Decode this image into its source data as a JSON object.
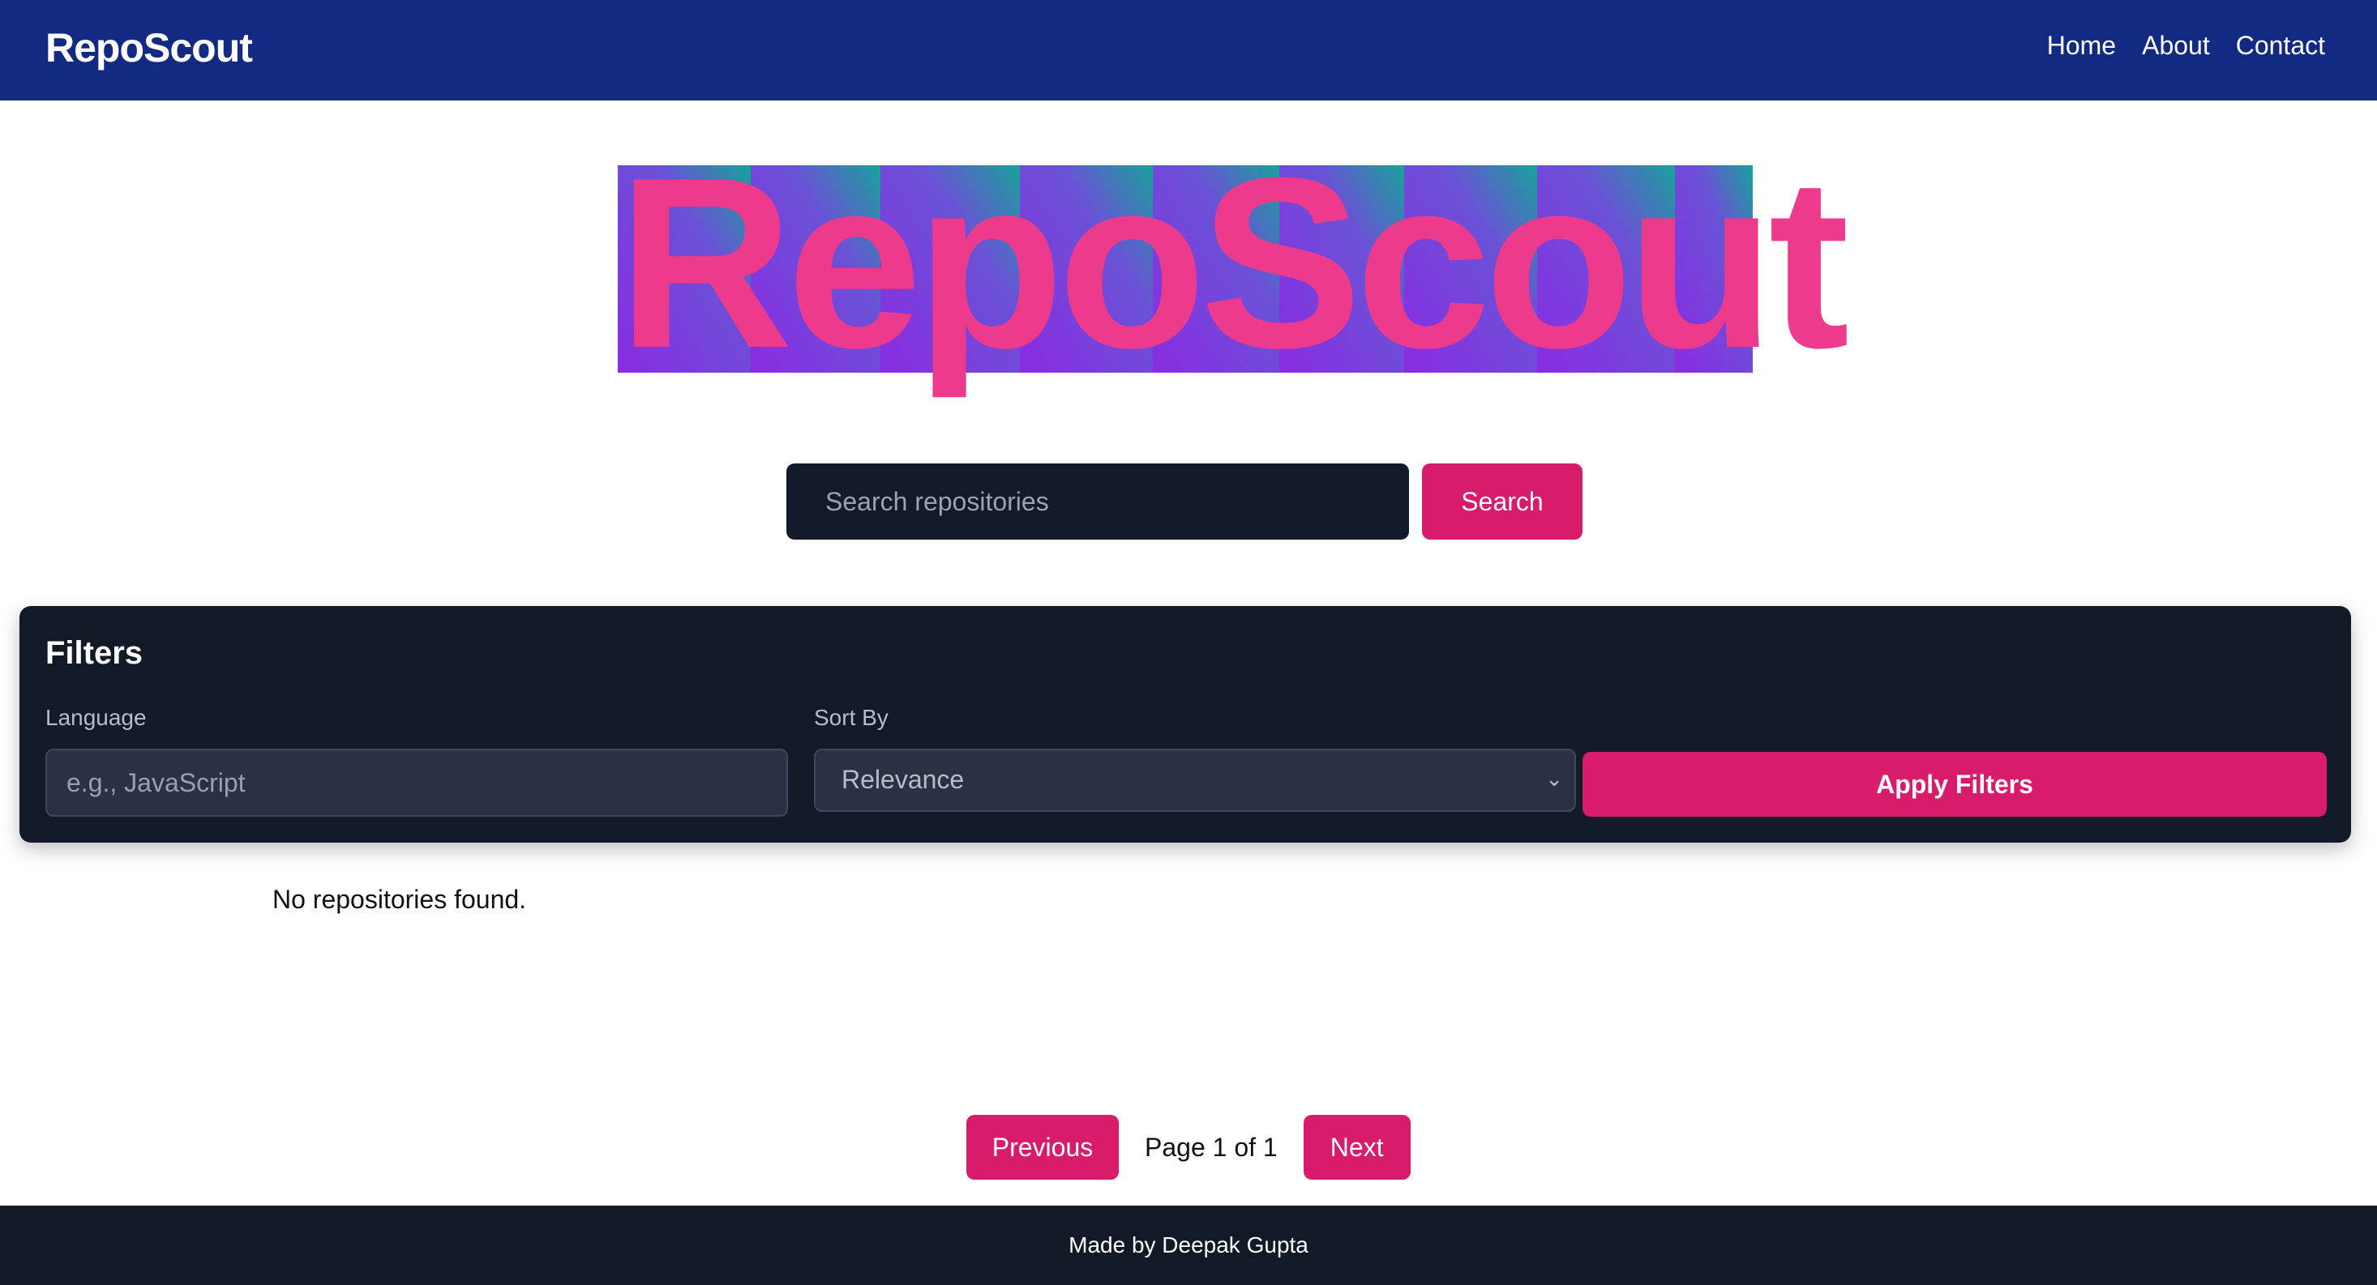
{
  "navbar": {
    "brand": "RepoScout",
    "links": [
      "Home",
      "About",
      "Contact"
    ]
  },
  "hero": {
    "title": "RepoScout",
    "text_color": "#ec3b8c"
  },
  "search": {
    "placeholder": "Search repositories",
    "button_label": "Search"
  },
  "filters": {
    "title": "Filters",
    "language_label": "Language",
    "language_placeholder": "e.g., JavaScript",
    "sort_label": "Sort By",
    "sort_value": "Relevance",
    "apply_label": "Apply Filters"
  },
  "results": {
    "empty_message": "No repositories found."
  },
  "pagination": {
    "previous_label": "Previous",
    "page_info": "Page 1 of 1",
    "next_label": "Next"
  },
  "footer": {
    "text": "Made by Deepak Gupta"
  },
  "colors": {
    "navbar": "#122a82",
    "accent": "#d81b6a",
    "panel": "#121a28"
  }
}
